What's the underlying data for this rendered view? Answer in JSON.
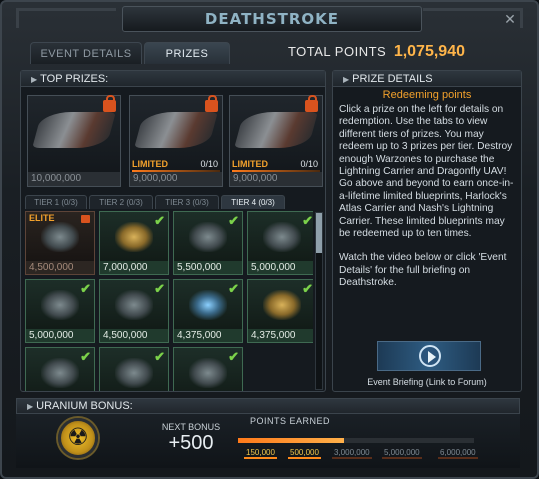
{
  "window": {
    "title": "DEATHSTROKE",
    "close_icon": "close-icon"
  },
  "tabs": [
    {
      "label": "EVENT DETAILS",
      "active": false
    },
    {
      "label": "PRIZES",
      "active": true
    }
  ],
  "total_points": {
    "label": "TOTAL POINTS",
    "value": "1,075,940"
  },
  "top_prizes": {
    "header": "TOP PRIZES:",
    "items": [
      {
        "price": "10,000,000",
        "limited": false,
        "locked": true
      },
      {
        "price": "9,000,000",
        "limited": true,
        "limited_label": "LIMITED",
        "limited_count": "0/10",
        "locked": true
      },
      {
        "price": "9,000,000",
        "limited": true,
        "limited_label": "LIMITED",
        "limited_count": "0/10",
        "locked": true
      }
    ]
  },
  "tier_tabs": [
    {
      "label": "TIER 1 (0/3)",
      "active": false
    },
    {
      "label": "TIER 2 (0/3)",
      "active": false
    },
    {
      "label": "TIER 3 (0/3)",
      "active": false
    },
    {
      "label": "TIER 4 (0/3)",
      "active": true
    }
  ],
  "tier_items": [
    {
      "price": "4,500,000",
      "elite": true,
      "elite_label": "ELITE",
      "status": "locked",
      "style": "grey"
    },
    {
      "price": "7,000,000",
      "elite": false,
      "status": "check",
      "style": "gold"
    },
    {
      "price": "5,500,000",
      "elite": false,
      "status": "check",
      "style": "grey"
    },
    {
      "price": "5,000,000",
      "elite": false,
      "status": "check",
      "style": "grey"
    },
    {
      "price": "5,000,000",
      "elite": false,
      "status": "check",
      "style": "grey"
    },
    {
      "price": "4,500,000",
      "elite": false,
      "status": "check",
      "style": "grey"
    },
    {
      "price": "4,375,000",
      "elite": false,
      "status": "check",
      "style": "blue"
    },
    {
      "price": "4,375,000",
      "elite": false,
      "status": "check",
      "style": "gold"
    },
    {
      "price": "",
      "elite": false,
      "status": "check",
      "style": "grey"
    },
    {
      "price": "",
      "elite": false,
      "status": "check",
      "style": "grey"
    },
    {
      "price": "",
      "elite": false,
      "status": "check",
      "style": "grey"
    }
  ],
  "prize_details": {
    "header": "PRIZE DETAILS",
    "title": "Redeeming points",
    "paragraph1": "Click a prize on the left for details on redemption. Use the tabs to view different tiers of prizes. You may redeem up to 3 prizes per tier. Destroy enough Warzones to purchase the Lightning Carrier and Dragonfly UAV! Go above and beyond to earn once-in-a-lifetime limited blueprints, Harlock's Atlas Carrier and Nash's Lightning Carrier. These limited blueprints may be redeemed up to ten times.",
    "paragraph2": "Watch the video below or click 'Event Details' for the full briefing on Deathstroke.",
    "video_link": "Event Briefing (Link to Forum)"
  },
  "uranium_bonus": {
    "header": "URANIUM BONUS:",
    "icon": "radiation-icon",
    "next_bonus_label": "NEXT BONUS",
    "next_bonus_value": "+500",
    "points_earned_label": "POINTS EARNED",
    "progress_fraction": 0.45,
    "milestones": [
      {
        "label": "150,000",
        "reached": true
      },
      {
        "label": "500,000",
        "reached": true
      },
      {
        "label": "3,000,000",
        "reached": false
      },
      {
        "label": "5,000,000",
        "reached": false
      },
      {
        "label": "6,000,000",
        "reached": false
      }
    ]
  },
  "colors": {
    "accent_orange": "#ffb54a",
    "check_green": "#7bd14a",
    "lock_orange": "#d9531e"
  }
}
